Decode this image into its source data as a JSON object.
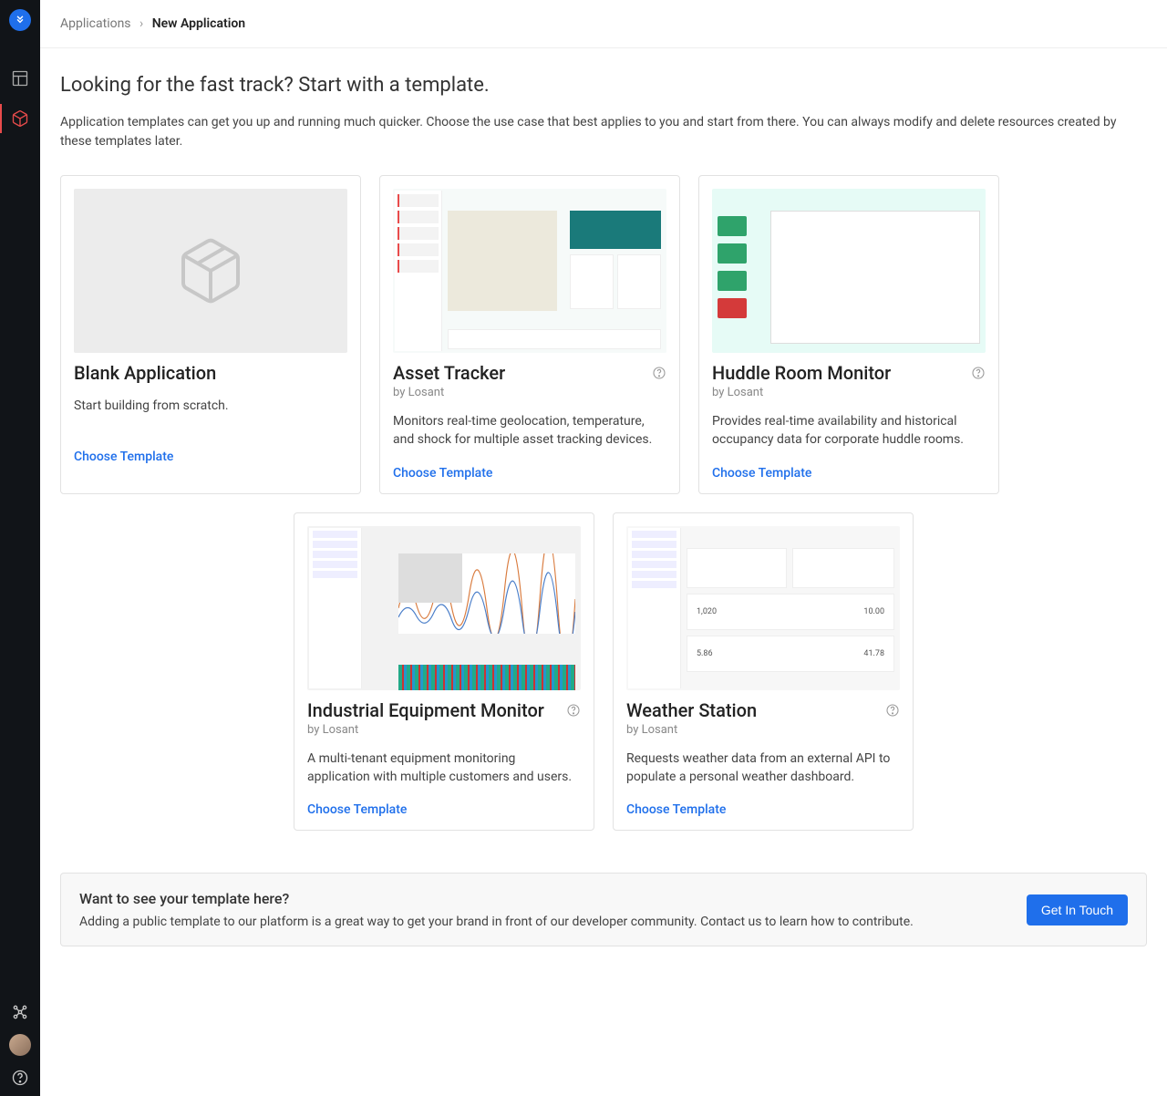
{
  "breadcrumb": {
    "parent": "Applications",
    "current": "New Application"
  },
  "page": {
    "title": "Looking for the fast track? Start with a template.",
    "description": "Application templates can get you up and running much quicker. Choose the use case that best applies to you and start from there. You can always modify and delete resources created by these templates later."
  },
  "choose_label": "Choose Template",
  "by_prefix": "by ",
  "templates": [
    {
      "id": "blank",
      "title": "Blank Application",
      "author": "",
      "description": "Start building from scratch.",
      "has_help": false,
      "preview_style": "blank"
    },
    {
      "id": "asset",
      "title": "Asset Tracker",
      "author": "Losant",
      "description": "Monitors real-time geolocation, temperature, and shock for multiple asset tracking devices.",
      "has_help": true,
      "preview_style": "asset"
    },
    {
      "id": "huddle",
      "title": "Huddle Room Monitor",
      "author": "Losant",
      "description": "Provides real-time availability and historical occupancy data for corporate huddle rooms.",
      "has_help": true,
      "preview_style": "huddle"
    },
    {
      "id": "industrial",
      "title": "Industrial Equipment Monitor",
      "author": "Losant",
      "description": "A multi-tenant equipment monitoring application with multiple customers and users.",
      "has_help": true,
      "preview_style": "industrial"
    },
    {
      "id": "weather",
      "title": "Weather Station",
      "author": "Losant",
      "description": "Requests weather data from an external API to populate a personal weather dashboard.",
      "has_help": true,
      "preview_style": "weather",
      "preview_numbers": {
        "a": "1,020",
        "b": "10.00",
        "c": "5.86",
        "d": "41.78"
      }
    }
  ],
  "footer": {
    "title": "Want to see your template here?",
    "description": "Adding a public template to our platform is a great way to get your brand in front of our developer community. Contact us to learn how to contribute.",
    "button": "Get In Touch"
  }
}
